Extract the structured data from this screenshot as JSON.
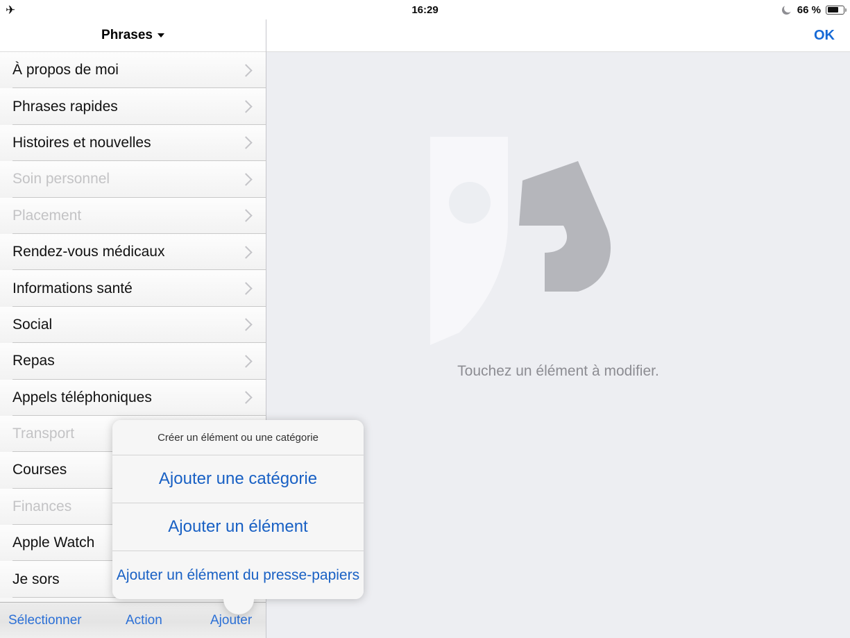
{
  "statusbar": {
    "airplane_icon": "airplane-mode-icon",
    "time": "16:29",
    "dnd_icon": "moon-do-not-disturb-icon",
    "battery_percent": "66 %",
    "battery_icon": "battery-icon"
  },
  "sidebar": {
    "title": "Phrases",
    "categories": [
      {
        "label": "À propos de moi",
        "disabled": false
      },
      {
        "label": "Phrases rapides",
        "disabled": false
      },
      {
        "label": "Histoires et nouvelles",
        "disabled": false
      },
      {
        "label": "Soin personnel",
        "disabled": true
      },
      {
        "label": "Placement",
        "disabled": true
      },
      {
        "label": "Rendez-vous médicaux",
        "disabled": false
      },
      {
        "label": "Informations santé",
        "disabled": false
      },
      {
        "label": "Social",
        "disabled": false
      },
      {
        "label": "Repas",
        "disabled": false
      },
      {
        "label": "Appels téléphoniques",
        "disabled": false
      },
      {
        "label": "Transport",
        "disabled": true
      },
      {
        "label": "Courses",
        "disabled": false
      },
      {
        "label": "Finances",
        "disabled": true
      },
      {
        "label": "Apple Watch",
        "disabled": false
      },
      {
        "label": "Je sors",
        "disabled": false
      }
    ]
  },
  "toolbar": {
    "select_label": "Sélectionner",
    "action_label": "Action",
    "add_label": "Ajouter"
  },
  "main": {
    "ok_label": "OK",
    "empty_message": "Touchez un élément à modifier.",
    "logo_name": "app-watermark-logo"
  },
  "popover": {
    "title": "Créer un élément ou une catégorie",
    "items": [
      "Ajouter une catégorie",
      "Ajouter un élément",
      "Ajouter un élément du presse-papiers"
    ]
  },
  "colors": {
    "accent_blue": "#1860c4",
    "toolbar_blue": "#2a6fd6",
    "ok_blue": "#1569d6",
    "disabled_gray": "#c3c3c5",
    "main_bg": "#edeef2",
    "popover_bg": "#f6f6f6"
  }
}
